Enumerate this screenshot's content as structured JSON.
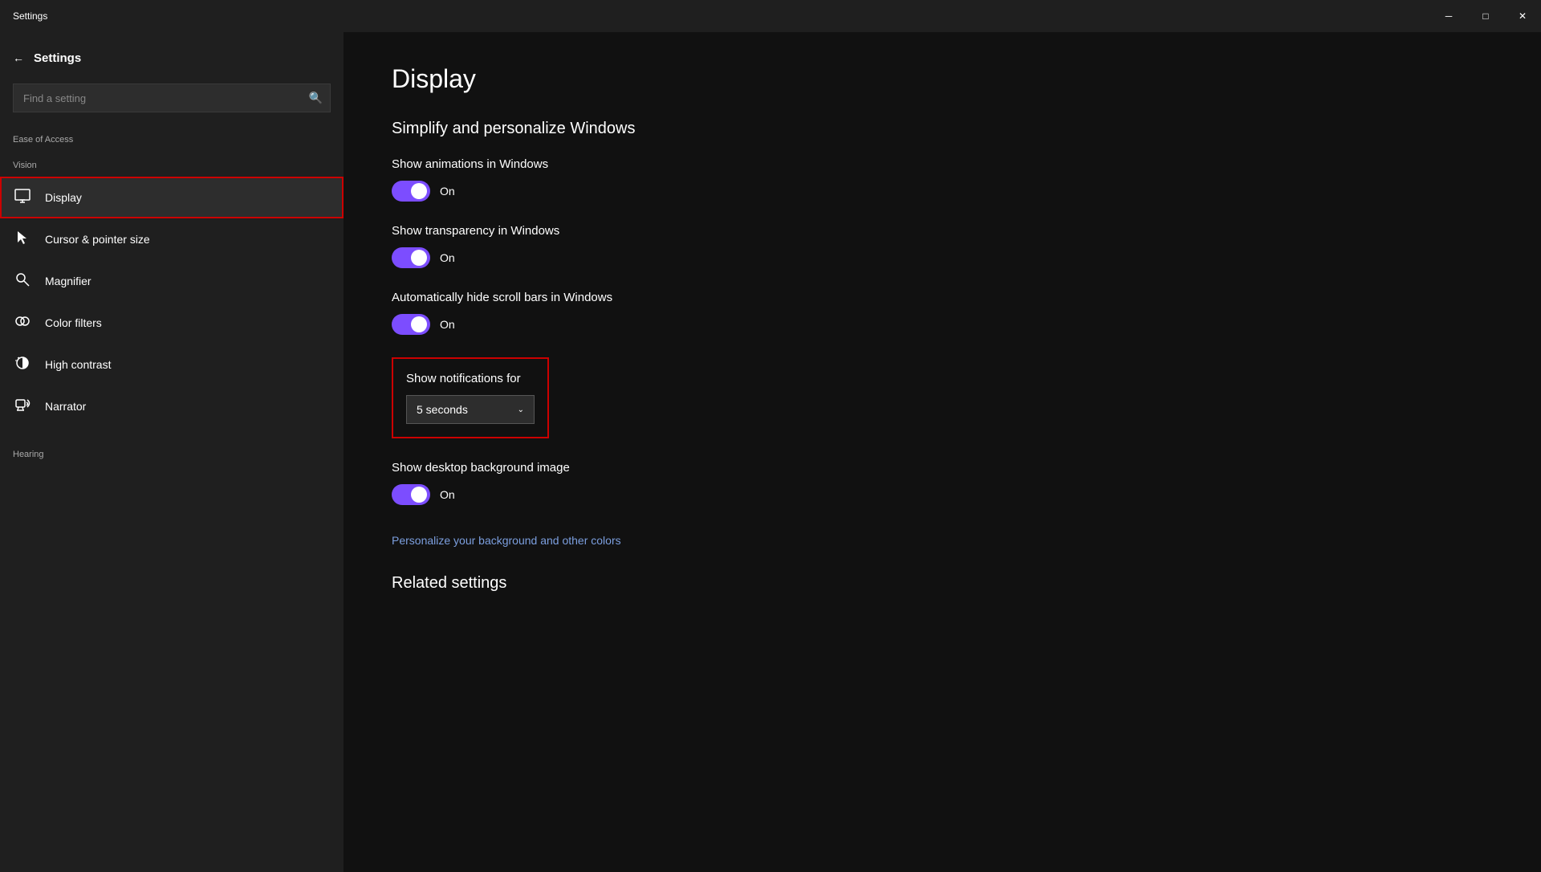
{
  "titleBar": {
    "title": "Settings",
    "minimizeLabel": "─",
    "maximizeLabel": "□",
    "closeLabel": "✕"
  },
  "sidebar": {
    "backLabel": "Settings",
    "searchPlaceholder": "Find a setting",
    "sectionLabels": {
      "vision": "Vision",
      "hearing": "Hearing"
    },
    "categoryLabel": "Ease of Access",
    "items": [
      {
        "id": "display",
        "label": "Display",
        "icon": "display",
        "active": true
      },
      {
        "id": "cursor",
        "label": "Cursor & pointer size",
        "icon": "cursor"
      },
      {
        "id": "magnifier",
        "label": "Magnifier",
        "icon": "magnifier"
      },
      {
        "id": "color-filters",
        "label": "Color filters",
        "icon": "color-filters"
      },
      {
        "id": "high-contrast",
        "label": "High contrast",
        "icon": "high-contrast"
      },
      {
        "id": "narrator",
        "label": "Narrator",
        "icon": "narrator"
      }
    ]
  },
  "main": {
    "pageTitle": "Display",
    "sectionTitle": "Simplify and personalize Windows",
    "settings": [
      {
        "id": "animations",
        "label": "Show animations in Windows",
        "toggleState": "on",
        "toggleText": "On"
      },
      {
        "id": "transparency",
        "label": "Show transparency in Windows",
        "toggleState": "on",
        "toggleText": "On"
      },
      {
        "id": "scrollbars",
        "label": "Automatically hide scroll bars in Windows",
        "toggleState": "on",
        "toggleText": "On"
      }
    ],
    "notificationsLabel": "Show notifications for",
    "notificationsValue": "5 seconds",
    "desktopBgLabel": "Show desktop background image",
    "desktopBgToggleText": "On",
    "personalizeLink": "Personalize your background and other colors",
    "relatedSettingsTitle": "Related settings"
  }
}
